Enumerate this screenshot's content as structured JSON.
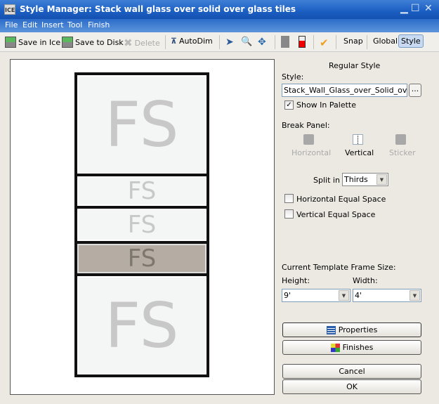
{
  "window": {
    "title": "Style Manager: Stack wall glass over solid  over glass tiles",
    "app_icon": "ICE"
  },
  "menu": [
    "File",
    "Edit",
    "Insert",
    "Tool",
    "Finish"
  ],
  "toolbar": {
    "save_ice": "Save in Ice",
    "save_disk": "Save to Disk",
    "delete": "Delete",
    "autodim": "AutoDim",
    "snap": "Snap",
    "global": "Global",
    "style": "Style"
  },
  "preview": {
    "panes": [
      {
        "text": "FS"
      },
      {
        "text": "FS"
      },
      {
        "text": "FS"
      },
      {
        "text": "FS",
        "tinted": true
      },
      {
        "text": "FS"
      }
    ]
  },
  "panel": {
    "heading": "Regular Style",
    "style_label": "Style:",
    "style_value": "Stack_Wall_Glass_over_Solid_over_Glass",
    "browse": "...",
    "show_in_palette": "Show In Palette",
    "show_in_palette_checked": true,
    "break_panel": "Break Panel:",
    "break_options": [
      "Horizontal",
      "Vertical",
      "Sticker"
    ],
    "break_selected": "Vertical",
    "split_label": "Split in",
    "split_value": "Thirds",
    "h_equal": "Horizontal Equal Space",
    "h_equal_checked": false,
    "v_equal": "Vertical Equal Space",
    "v_equal_checked": false,
    "frame_size": "Current Template Frame Size:",
    "height_label": "Height:",
    "height_value": "9'",
    "width_label": "Width:",
    "width_value": "4'",
    "properties": "Properties",
    "finishes": "Finishes",
    "cancel": "Cancel",
    "ok": "OK"
  }
}
